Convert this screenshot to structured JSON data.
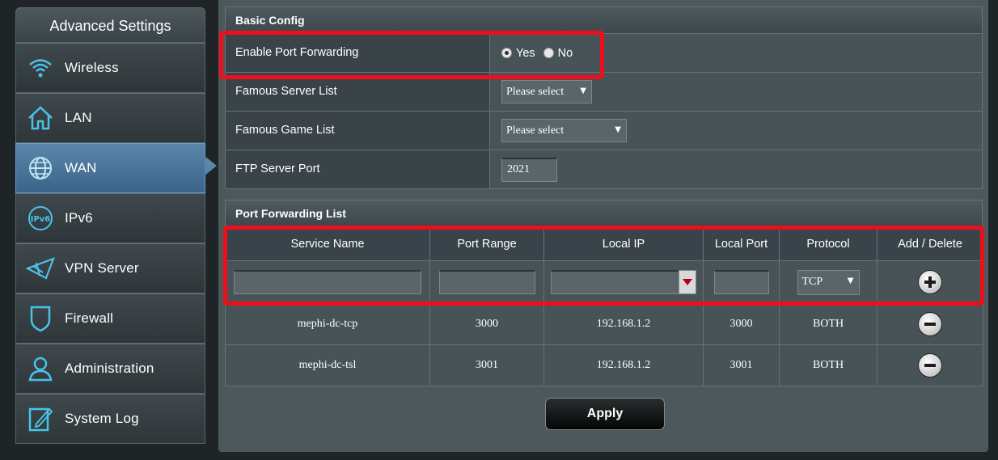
{
  "sidebar": {
    "title": "Advanced Settings",
    "items": [
      {
        "label": "Wireless",
        "icon": "wifi-icon"
      },
      {
        "label": "LAN",
        "icon": "home-icon"
      },
      {
        "label": "WAN",
        "icon": "globe-icon",
        "active": true
      },
      {
        "label": "IPv6",
        "icon": "ipv6-icon"
      },
      {
        "label": "VPN Server",
        "icon": "vpn-icon"
      },
      {
        "label": "Firewall",
        "icon": "shield-icon"
      },
      {
        "label": "Administration",
        "icon": "user-icon"
      },
      {
        "label": "System Log",
        "icon": "log-icon"
      }
    ]
  },
  "basic_config": {
    "title": "Basic Config",
    "enable_port_forwarding": {
      "label": "Enable Port Forwarding",
      "yes_label": "Yes",
      "no_label": "No",
      "selected": "Yes"
    },
    "famous_server_list": {
      "label": "Famous Server List",
      "value": "Please select"
    },
    "famous_game_list": {
      "label": "Famous Game List",
      "value": "Please select"
    },
    "ftp_server_port": {
      "label": "FTP Server Port",
      "value": "2021"
    }
  },
  "port_forwarding_list": {
    "title": "Port Forwarding List",
    "columns": [
      "Service Name",
      "Port Range",
      "Local IP",
      "Local Port",
      "Protocol",
      "Add / Delete"
    ],
    "new_entry": {
      "protocol": "TCP"
    },
    "rows": [
      {
        "service_name": "mephi-dc-tcp",
        "port_range": "3000",
        "local_ip": "192.168.1.2",
        "local_port": "3000",
        "protocol": "BOTH"
      },
      {
        "service_name": "mephi-dc-tsl",
        "port_range": "3001",
        "local_ip": "192.168.1.2",
        "local_port": "3001",
        "protocol": "BOTH"
      }
    ]
  },
  "apply_label": "Apply",
  "colors": {
    "highlight": "#ee0f1d",
    "active_tab": "#5b86ac",
    "panel": "#4d585d"
  }
}
